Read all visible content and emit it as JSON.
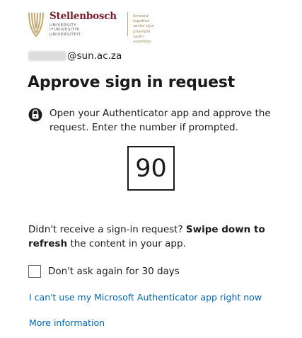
{
  "logo": {
    "name": "Stellenbosch",
    "sub_lines": [
      "UNIVERSITY",
      "IYUNIVESITHI",
      "UNIVERSITEIT"
    ],
    "tagline_lines": [
      "forward together",
      "sonke siya phambili",
      "saam vorentoe"
    ],
    "brand_color": "#7a1c2b",
    "accent_color": "#c4a66b"
  },
  "account": {
    "email_suffix": "@sun.ac.za"
  },
  "page": {
    "title": "Approve sign in request",
    "instruction": "Open your Authenticator app and approve the request. Enter the number if prompted.",
    "number": "90"
  },
  "help": {
    "prefix": "Didn't receive a sign-in request? ",
    "bold1": "Swipe down to",
    "bold2": "refresh",
    "suffix": " the content in your app."
  },
  "checkbox": {
    "label": "Don't ask again for 30 days",
    "checked": false
  },
  "links": {
    "cant_use": "I can't use my Microsoft Authenticator app right now",
    "more_info": "More information",
    "link_color": "#0067b8"
  },
  "icons": {
    "logo": "stellenbosch-crest-icon",
    "instruction": "authenticator-lock-icon"
  }
}
